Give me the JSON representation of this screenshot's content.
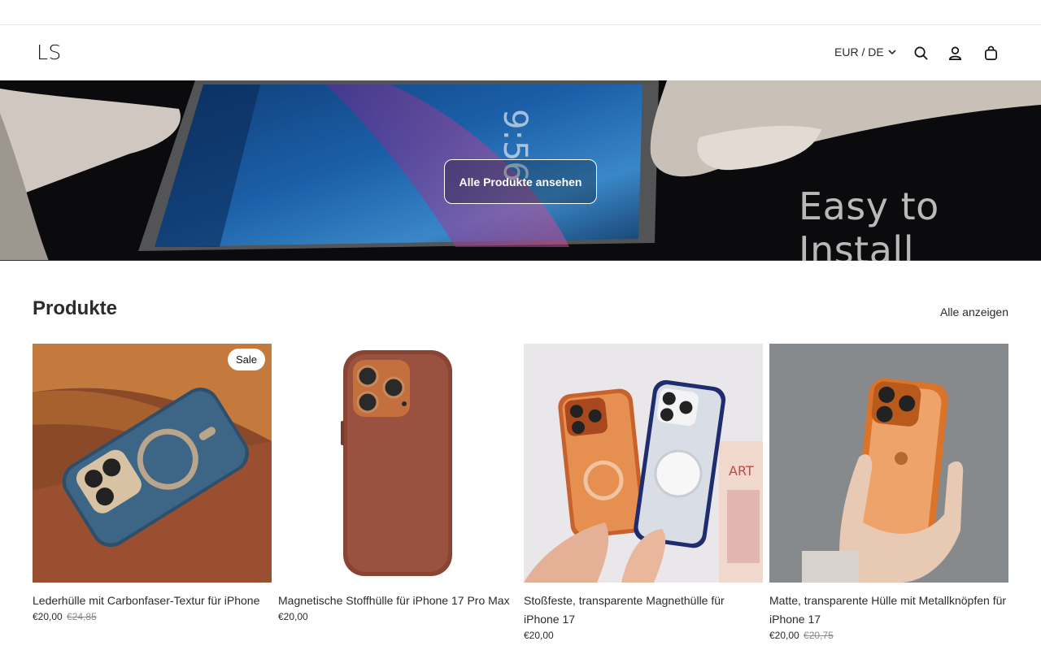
{
  "header": {
    "logo": "LS",
    "locale": "EUR / DE"
  },
  "icons": {
    "search": "search-icon",
    "account": "account-icon",
    "cart": "shopping-bag-icon",
    "locale_chevron": "chevron-down-icon"
  },
  "hero": {
    "button_label": "Alle Produkte ansehen",
    "overlay_text": "Easy to Install"
  },
  "products_section": {
    "title": "Produkte",
    "view_all": "Alle anzeigen",
    "items": [
      {
        "title": "Lederhülle mit Carbonfaser-Textur für iPhone",
        "price": "€20,00",
        "compare_price": "€24,85",
        "badge": "Sale"
      },
      {
        "title": "Magnetische Stoffhülle für iPhone 17 Pro Max",
        "price": "€20,00",
        "compare_price": "",
        "badge": ""
      },
      {
        "title": "Stoßfeste, transparente Magnethülle für iPhone 17",
        "price": "€20,00",
        "compare_price": "",
        "badge": ""
      },
      {
        "title": "Matte, transparente Hülle mit Metallknöpfen für iPhone 17",
        "price": "€20,00",
        "compare_price": "€20,75",
        "badge": ""
      }
    ]
  },
  "colors": {
    "text": "#121212",
    "muted": "#8a8a8a",
    "hero_bg": "#0b0b0d"
  }
}
